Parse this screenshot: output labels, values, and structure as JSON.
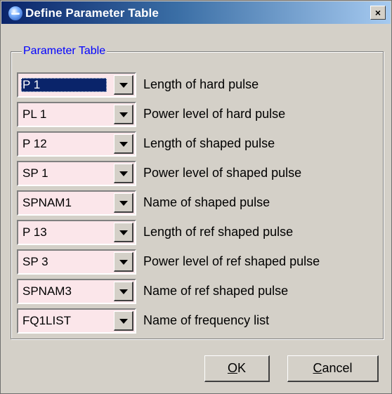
{
  "window": {
    "title": "Define Parameter Table",
    "close_label": "×"
  },
  "group": {
    "label": "Parameter Table"
  },
  "rows": [
    {
      "value": "P 1",
      "label": "Length of hard pulse"
    },
    {
      "value": "PL 1",
      "label": "Power level of hard pulse"
    },
    {
      "value": "P 12",
      "label": "Length of shaped pulse"
    },
    {
      "value": "SP 1",
      "label": "Power level of shaped pulse"
    },
    {
      "value": "SPNAM1",
      "label": "Name of shaped pulse"
    },
    {
      "value": "P 13",
      "label": "Length of ref shaped pulse"
    },
    {
      "value": "SP 3",
      "label": "Power level of ref shaped pulse"
    },
    {
      "value": "SPNAM3",
      "label": "Name of ref shaped pulse"
    },
    {
      "value": "FQ1LIST",
      "label": "Name of frequency list"
    }
  ],
  "buttons": {
    "ok_mnemonic": "O",
    "ok_rest": "K",
    "cancel_mnemonic": "C",
    "cancel_rest": "ancel"
  },
  "colors": {
    "field_bg": "#fbe6ea",
    "title_start": "#0a246a",
    "group_label": "#0000ff"
  }
}
